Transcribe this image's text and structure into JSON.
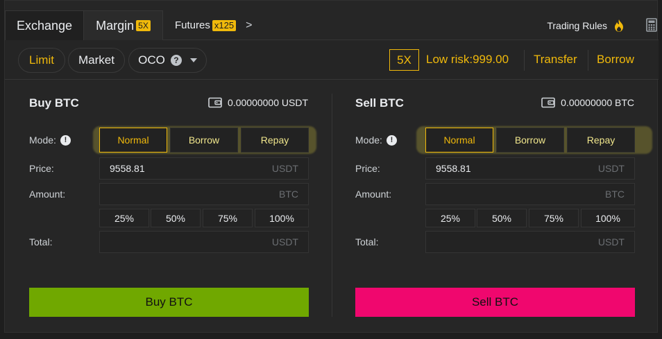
{
  "tabs": {
    "exchange": "Exchange",
    "margin": "Margin",
    "margin_badge": "5X",
    "futures": "Futures",
    "futures_badge": "x125",
    "more": ">"
  },
  "trading_rules": "Trading Rules",
  "order_types": {
    "limit": "Limit",
    "market": "Market",
    "oco": "OCO",
    "help": "?"
  },
  "leverage": "5X",
  "risk": "Low risk:999.00",
  "transfer": "Transfer",
  "borrow_link": "Borrow",
  "buy": {
    "title": "Buy BTC",
    "balance": "0.00000000 USDT",
    "mode_label": "Mode:",
    "mode_info": "!",
    "modes": {
      "normal": "Normal",
      "borrow": "Borrow",
      "repay": "Repay"
    },
    "price_label": "Price:",
    "price_value": "9558.81",
    "price_unit": "USDT",
    "amount_label": "Amount:",
    "amount_value": "",
    "amount_unit": "BTC",
    "pcts": [
      "25%",
      "50%",
      "75%",
      "100%"
    ],
    "total_label": "Total:",
    "total_value": "",
    "total_unit": "USDT",
    "action": "Buy BTC"
  },
  "sell": {
    "title": "Sell BTC",
    "balance": "0.00000000 BTC",
    "mode_label": "Mode:",
    "mode_info": "!",
    "modes": {
      "normal": "Normal",
      "borrow": "Borrow",
      "repay": "Repay"
    },
    "price_label": "Price:",
    "price_value": "9558.81",
    "price_unit": "USDT",
    "amount_label": "Amount:",
    "amount_value": "",
    "amount_unit": "BTC",
    "pcts": [
      "25%",
      "50%",
      "75%",
      "100%"
    ],
    "total_label": "Total:",
    "total_value": "",
    "total_unit": "USDT",
    "action": "Sell BTC"
  },
  "colors": {
    "accent": "#f0b90b",
    "buy": "#70a800",
    "sell": "#f0076e",
    "background": "#262626"
  },
  "icons": {
    "fire": "fire-icon",
    "calculator": "calculator-icon",
    "wallet": "wallet-icon",
    "info": "info-icon",
    "help": "help-icon"
  }
}
